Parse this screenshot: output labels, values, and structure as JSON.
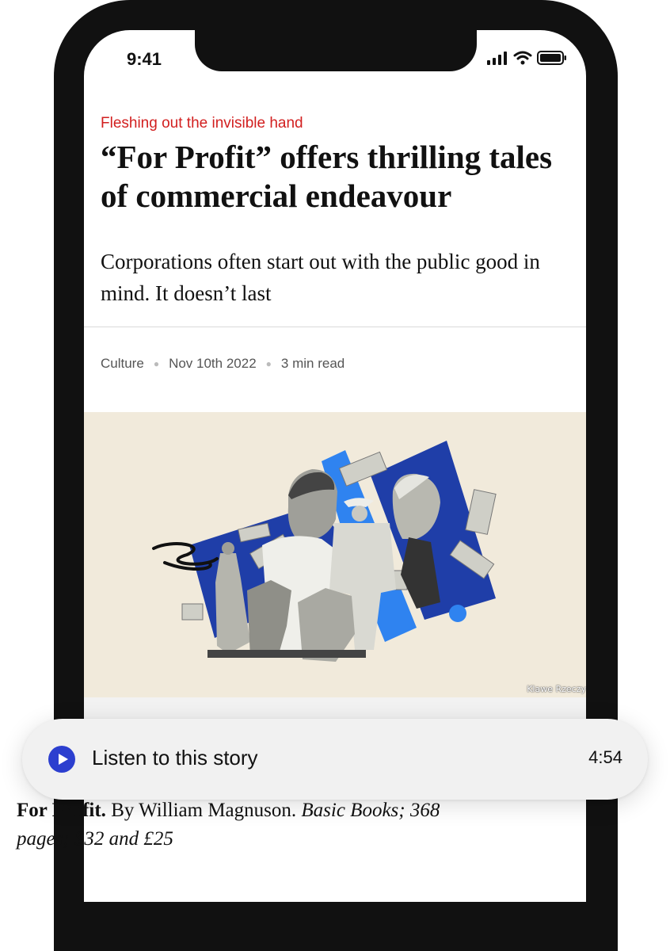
{
  "status_bar": {
    "time": "9:41"
  },
  "article": {
    "kicker": "Fleshing out the invisible hand",
    "headline": "“For Profit” offers thrilling tales of commercial endeavour",
    "standfirst": "Corporations often start out with the public good in mind. It doesn’t last",
    "section": "Culture",
    "date": "Nov 10th 2022",
    "read_time": "3 min read",
    "image_credit": "Klawe Rzeczy",
    "book_title": "For Profit.",
    "book_author": "By William Magnuson.",
    "book_details": "Basic Books; 368 pages; $32 and £25"
  },
  "audio_player": {
    "label": "Listen to this story",
    "duration": "4:54"
  },
  "colors": {
    "kicker_red": "#d21f1f",
    "play_blue": "#2c3fcf",
    "hero_background": "#f1eadb",
    "collage_dark_blue": "#1f3ea8",
    "collage_light_blue": "#2f83f0"
  },
  "icons": [
    "signal-icon",
    "wifi-icon",
    "battery-icon",
    "play-icon"
  ]
}
